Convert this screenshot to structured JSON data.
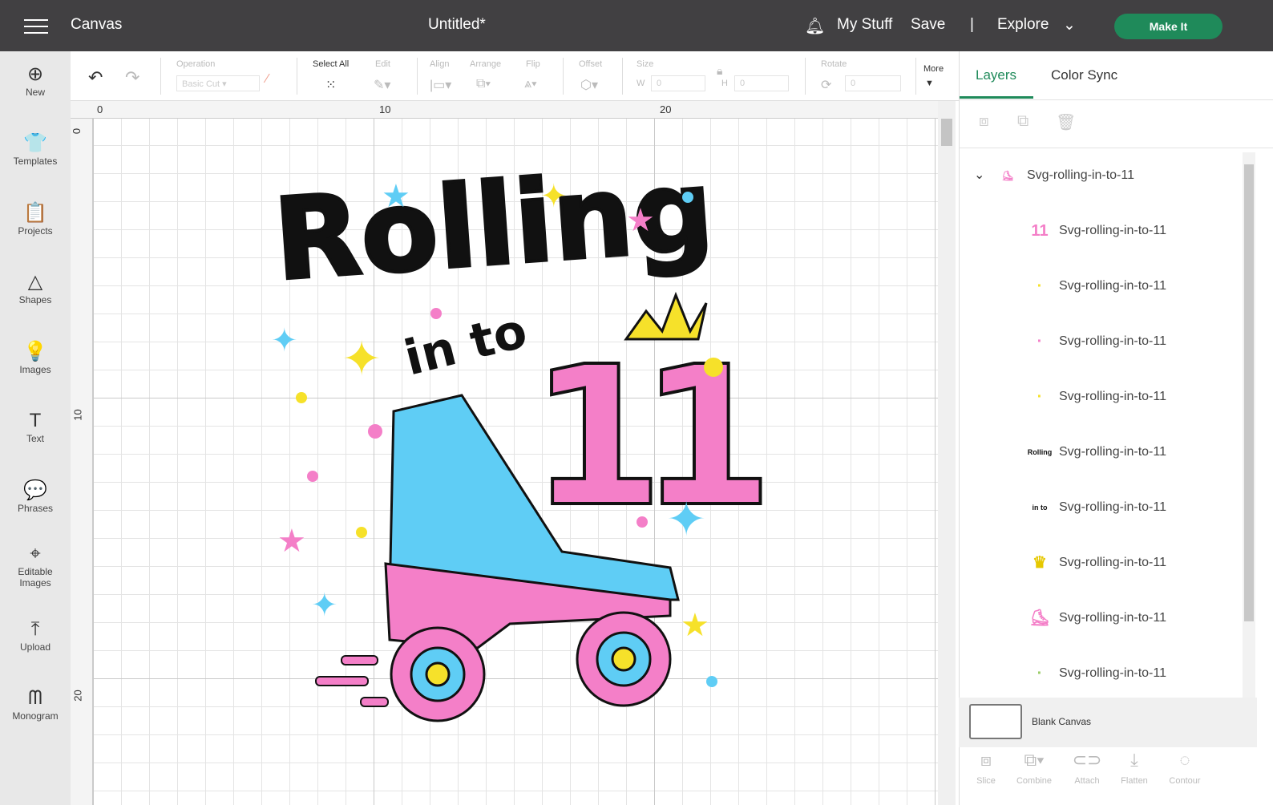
{
  "topbar": {
    "app": "Canvas",
    "title": "Untitled*",
    "my_stuff": "My Stuff",
    "save": "Save",
    "divider": "|",
    "explore": "Explore",
    "make_it": "Make It"
  },
  "sidebar": [
    {
      "label": "New",
      "icon": "⊕"
    },
    {
      "label": "Templates",
      "icon": "👕"
    },
    {
      "label": "Projects",
      "icon": "📋"
    },
    {
      "label": "Shapes",
      "icon": "△"
    },
    {
      "label": "Images",
      "icon": "💡"
    },
    {
      "label": "Text",
      "icon": "T"
    },
    {
      "label": "Phrases",
      "icon": "💬"
    },
    {
      "label": "Editable Images",
      "icon": "⌖"
    },
    {
      "label": "Upload",
      "icon": "⤒"
    },
    {
      "label": "Monogram",
      "icon": "ᗰ"
    }
  ],
  "toolbar": {
    "operation_label": "Operation",
    "operation_value": "Basic Cut",
    "select_all": "Select All",
    "edit": "Edit",
    "align": "Align",
    "arrange": "Arrange",
    "flip": "Flip",
    "offset": "Offset",
    "size": "Size",
    "w_label": "W",
    "w_value": "0",
    "h_label": "H",
    "h_value": "0",
    "rotate": "Rotate",
    "rotate_value": "0",
    "more": "More"
  },
  "ruler": {
    "top": [
      "0",
      "10",
      "20"
    ],
    "left": [
      "0",
      "10",
      "20"
    ]
  },
  "artwork": {
    "line1": "Rolling",
    "line2": "in to",
    "line3": "11"
  },
  "panel": {
    "tabs": [
      "Layers",
      "Color Sync"
    ],
    "group": "Svg-rolling-in-to-11",
    "layers": [
      {
        "name": "Svg-rolling-in-to-11",
        "thumb": "11"
      },
      {
        "name": "Svg-rolling-in-to-11",
        "thumb": "·"
      },
      {
        "name": "Svg-rolling-in-to-11",
        "thumb": "·"
      },
      {
        "name": "Svg-rolling-in-to-11",
        "thumb": "·"
      },
      {
        "name": "Svg-rolling-in-to-11",
        "thumb": "Rolling"
      },
      {
        "name": "Svg-rolling-in-to-11",
        "thumb": "in to"
      },
      {
        "name": "Svg-rolling-in-to-11",
        "thumb": "♛"
      },
      {
        "name": "Svg-rolling-in-to-11",
        "thumb": "⛸"
      },
      {
        "name": "Svg-rolling-in-to-11",
        "thumb": "·"
      }
    ],
    "blank_canvas": "Blank Canvas",
    "actions": [
      "Slice",
      "Combine",
      "Attach",
      "Flatten",
      "Contour"
    ]
  },
  "colors": {
    "topbar": "#414042",
    "accent": "#1f8a5a",
    "pink": "#f47fc8",
    "blue": "#5fcdf5",
    "yellow": "#f6e12a"
  }
}
